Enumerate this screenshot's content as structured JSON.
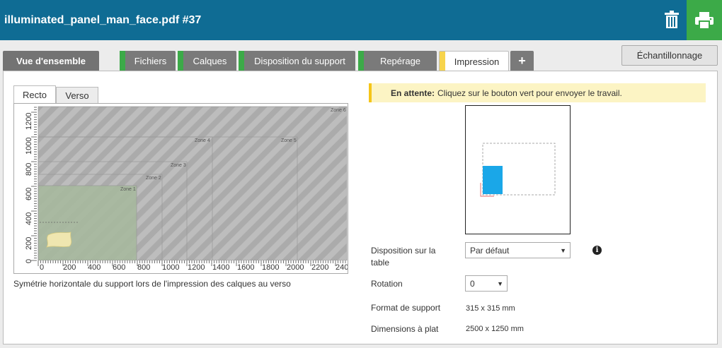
{
  "window": {
    "title": "illuminated_panel_man_face.pdf #37"
  },
  "tabs": [
    {
      "label": "Vue d'ensemble"
    },
    {
      "label": "Fichiers"
    },
    {
      "label": "Calques"
    },
    {
      "label": "Disposition du support"
    },
    {
      "label": "Repérage"
    },
    {
      "label": "Impression"
    },
    {
      "label": "+"
    }
  ],
  "sampling_label": "Échantillonnage",
  "sides": {
    "recto": "Recto",
    "verso": "Verso"
  },
  "preview": {
    "zones": [
      "Zone 1",
      "Zone 2",
      "Zone 3",
      "Zone 4",
      "Zone 5",
      "Zone 6"
    ],
    "x_ticks": [
      "0",
      "200",
      "400",
      "600",
      "800",
      "1000",
      "1200",
      "1400",
      "1600",
      "1800",
      "2000",
      "2200",
      "240"
    ],
    "y_ticks": [
      "0",
      "200",
      "400",
      "600",
      "800",
      "1000",
      "1200"
    ],
    "caption": "Symétrie horizontale du support lors de l'impression des calques au verso"
  },
  "status": {
    "bold": "En attente:",
    "text": "Cliquez sur le bouton vert pour envoyer le travail."
  },
  "form": {
    "layout_label": "Disposition sur la table",
    "layout_value": "Par défaut",
    "rotation_label": "Rotation",
    "rotation_value": "0",
    "media_format_label": "Format de support",
    "media_format_value": "315 x 315 mm",
    "flat_dim_label": "Dimensions à plat",
    "flat_dim_value": "2500 x 1250 mm"
  },
  "colors": {
    "header": "#0f6c94",
    "accent_green": "#3caa48",
    "status_yellow": "#f5c518",
    "media_blue": "#1aa7e8"
  },
  "icons": {
    "trash": "trash-icon",
    "print": "printer-icon",
    "info": "info-icon"
  }
}
